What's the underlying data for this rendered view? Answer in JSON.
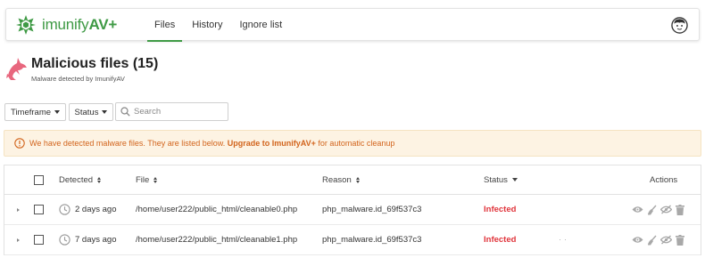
{
  "app": {
    "logo_text_light": "imunify",
    "logo_text_bold": "AV+",
    "brand_color": "#3f9a45"
  },
  "nav": {
    "tabs": [
      {
        "label": "Files",
        "active": true
      },
      {
        "label": "History",
        "active": false
      },
      {
        "label": "Ignore list",
        "active": false
      }
    ],
    "user_icon": "user-avatar-icon"
  },
  "header": {
    "title": "Malicious files (15)",
    "subtitle": "Malware detected by ImunifyAV",
    "icon": "shark-icon",
    "icon_color": "#e8677e"
  },
  "filters": {
    "timeframe_label": "Timeframe",
    "status_label": "Status",
    "search_placeholder": "Search",
    "search_value": ""
  },
  "alert": {
    "text_before": "We have detected malware files. They are listed below. ",
    "upgrade_link": "Upgrade to ImunifyAV+",
    "text_after": " for automatic cleanup",
    "color": "#d2641c"
  },
  "table": {
    "columns": {
      "detected": "Detected",
      "file": "File",
      "reason": "Reason",
      "status": "Status",
      "actions": "Actions"
    },
    "rows": [
      {
        "detected": "2 days ago",
        "file": "/home/user222/public_html/cleanable0.php",
        "reason": "php_malware.id_69f537c3",
        "status": "Infected"
      },
      {
        "detected": "7 days ago",
        "file": "/home/user222/public_html/cleanable1.php",
        "reason": "php_malware.id_69f537c3",
        "status": "Infected"
      }
    ],
    "status_color": "#e0343b",
    "action_icons": [
      "eye-icon",
      "cleanup-icon",
      "ignore-icon",
      "trash-icon"
    ]
  }
}
